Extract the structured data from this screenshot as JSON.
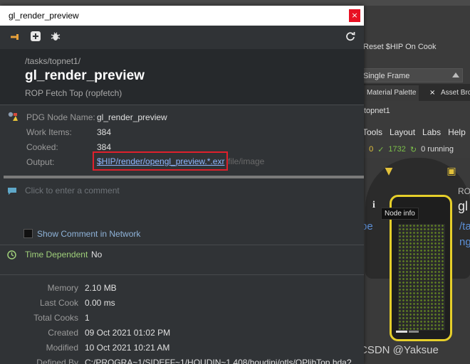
{
  "background_app": {
    "parm_label": "Reset $HIP On Cook",
    "dropdown_value": "Single Frame",
    "pane_tabs": [
      "Material Palette",
      "Asset Browser"
    ],
    "tab_close": "×",
    "network_path": "topnet1",
    "menus": [
      "Tools",
      "Layout",
      "Labs",
      "Help"
    ],
    "status": {
      "warn": "0",
      "done": "1732",
      "running": "0 running"
    },
    "node_label_small": "ROP",
    "node_label_big": "gl",
    "node_path_1": "/tasks",
    "node_path_2": "ng",
    "left_type_text": "pe",
    "info_button": "i",
    "tooltip": "Node info",
    "watermark": "CSDN @Yaksue"
  },
  "window": {
    "title": "gl_render_preview",
    "close_glyph": "×",
    "header": {
      "path": "/tasks/topnet1/",
      "name": "gl_render_preview",
      "type": "ROP Fetch Top (ropfetch)"
    },
    "info": {
      "pdg_label": "PDG Node Name:",
      "pdg_value": "gl_render_preview",
      "work_label": "Work Items:",
      "work_value": "384",
      "cooked_label": "Cooked:",
      "cooked_value": "384",
      "output_label": "Output:",
      "output_link": "$HIP/render/opengl_preview.*.exr",
      "output_suffix": "file/image"
    },
    "comment": {
      "placeholder": "Click to enter a comment",
      "show_in_network": "Show Comment in Network"
    },
    "time_dependent": {
      "label": "Time Dependent",
      "value": "No"
    },
    "stats": [
      {
        "label": "Memory",
        "value": "2.10 MB"
      },
      {
        "label": "Last Cook",
        "value": "0.00 ms"
      },
      {
        "label": "Total Cooks",
        "value": "1"
      },
      {
        "label": "Created",
        "value": "09 Oct 2021 01:02 PM"
      },
      {
        "label": "Modified",
        "value": "10 Oct 2021 10:21 AM"
      },
      {
        "label": "Defined By",
        "value": "C:/PROGRA~1/SIDEFF~1/HOUDIN~1.408/houdini/otls/OPlibTop.hda?"
      }
    ]
  },
  "colors": {
    "window_bg": "#303336",
    "header_bg": "#26292c",
    "link": "#8fb7ff",
    "highlight_box": "#e0202c",
    "node_border": "#e6cf2a"
  }
}
